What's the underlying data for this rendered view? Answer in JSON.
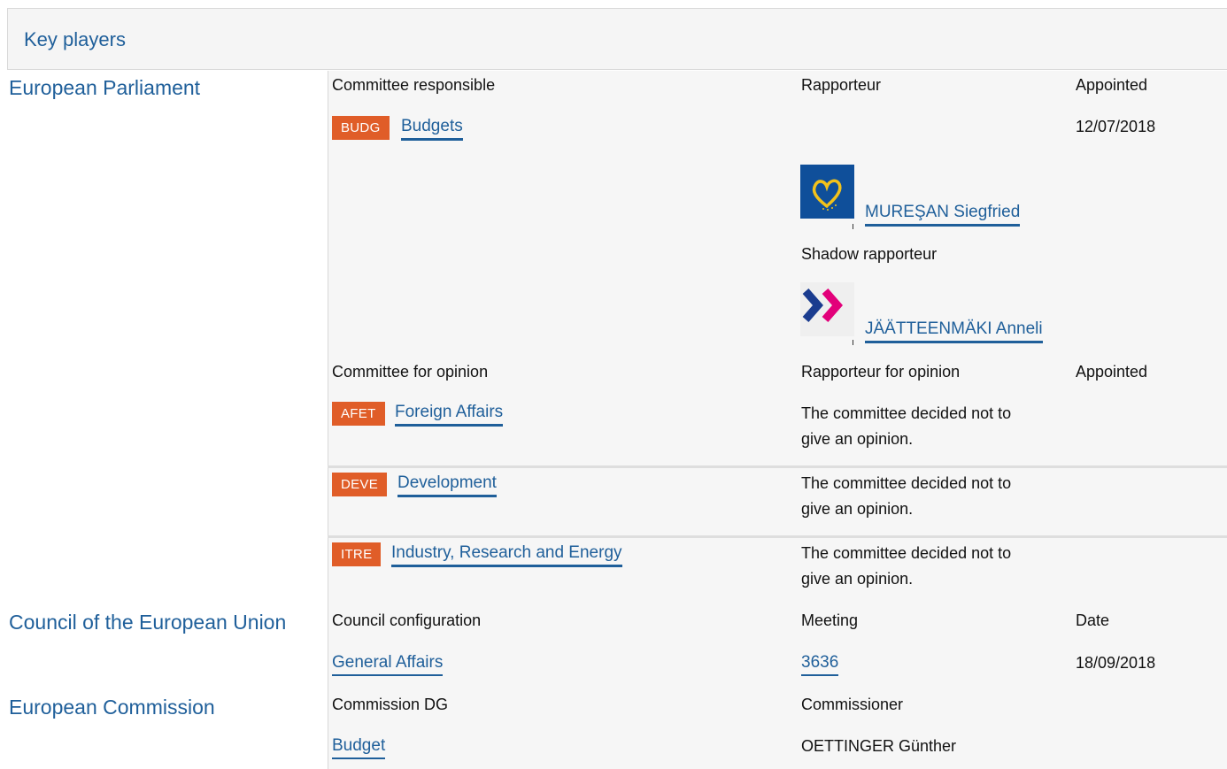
{
  "header": {
    "title": "Key players"
  },
  "institutions": {
    "parliament": "European Parliament",
    "council": "Council of the European Union",
    "commission": "European Commission"
  },
  "parliament": {
    "responsible_header": "Committee responsible",
    "rapporteur_header": "Rapporteur",
    "appointed_header": "Appointed",
    "responsible": {
      "code": "BUDG",
      "name": "Budgets",
      "appointed": "12/07/2018"
    },
    "rapporteur": {
      "name": "MUREŞAN Siegfried",
      "group_logo": "epp-heart-logo"
    },
    "shadow_label": "Shadow rapporteur",
    "shadow": {
      "name": "JÄÄTTEENMÄKI Anneli",
      "group_logo": "alde-chevron-logo"
    },
    "opinion_header": "Committee for opinion",
    "opinion_rapporteur_header": "Rapporteur for opinion",
    "opinion_appointed_header": "Appointed",
    "opinions": [
      {
        "code": "AFET",
        "name": "Foreign Affairs",
        "line1": "The committee decided not to",
        "line2": "give an opinion."
      },
      {
        "code": "DEVE",
        "name": "Development",
        "line1": "The committee decided not to",
        "line2": "give an opinion."
      },
      {
        "code": "ITRE",
        "name": "Industry, Research and Energy",
        "line1": "The committee decided not to",
        "line2": "give an opinion."
      }
    ]
  },
  "council": {
    "config_header": "Council configuration",
    "meeting_header": "Meeting",
    "date_header": "Date",
    "config": "General Affairs",
    "meeting": "3636",
    "date": "18/09/2018"
  },
  "commission": {
    "dg_header": "Commission DG",
    "commissioner_header": "Commissioner",
    "dg": "Budget",
    "commissioner": "OETTINGER Günther"
  },
  "colors": {
    "accent": "#1f5f9a",
    "badge": "#e05d28",
    "panel": "#f6f6f6"
  }
}
